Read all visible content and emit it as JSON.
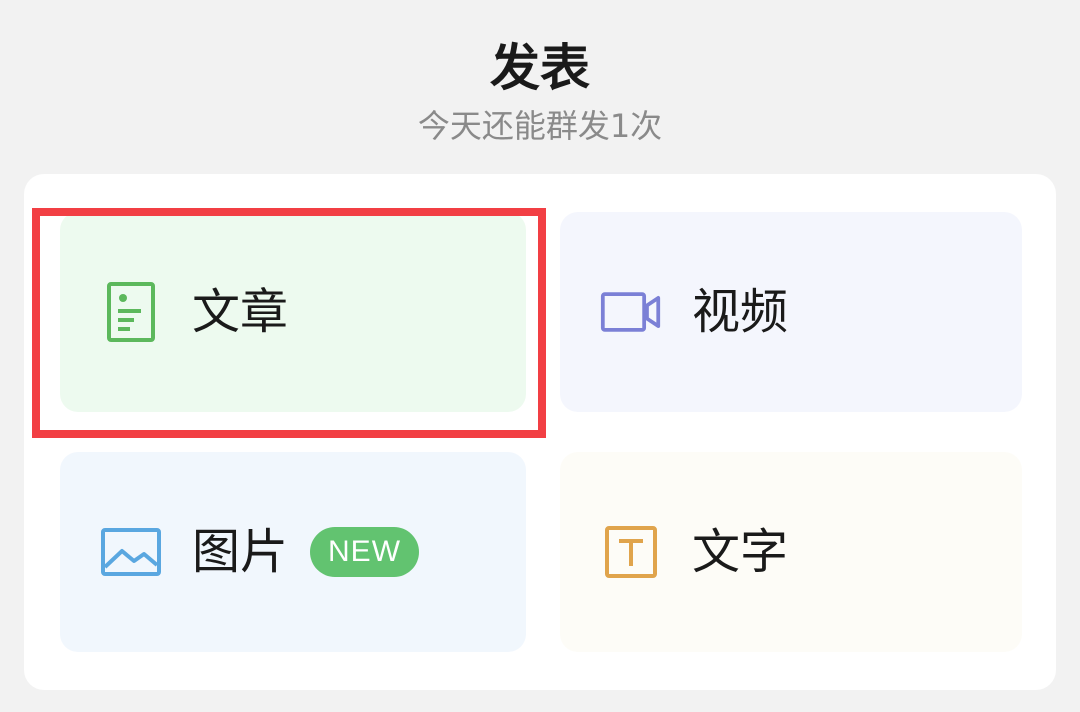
{
  "header": {
    "title": "发表",
    "subtitle": "今天还能群发1次"
  },
  "options": {
    "article": {
      "label": "文章",
      "icon": "document-icon",
      "icon_color": "#5cb85c"
    },
    "video": {
      "label": "视频",
      "icon": "video-camera-icon",
      "icon_color": "#7b80d6"
    },
    "image": {
      "label": "图片",
      "icon": "image-icon",
      "icon_color": "#5aa7e0",
      "badge": "NEW",
      "badge_color": "#62c370"
    },
    "text": {
      "label": "文字",
      "icon": "text-t-icon",
      "icon_color": "#e0a44c"
    }
  },
  "highlight": {
    "color": "#f23f44",
    "target": "article"
  }
}
